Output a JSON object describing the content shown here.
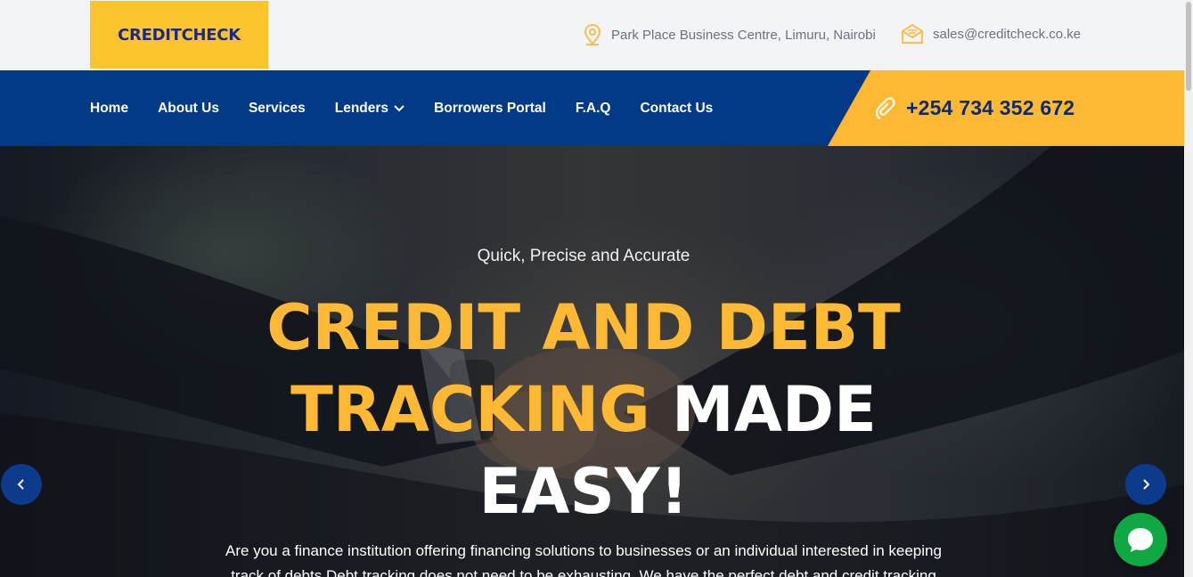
{
  "brand": {
    "logo_text": "CREDITCHECK"
  },
  "topbar": {
    "address": "Park Place Business Centre, Limuru, Nairobi",
    "email": "sales@creditcheck.co.ke",
    "address_icon": "map-pin-icon",
    "email_icon": "envelope-icon"
  },
  "nav": {
    "items": [
      {
        "label": "Home"
      },
      {
        "label": "About Us"
      },
      {
        "label": "Services"
      },
      {
        "label": "Lenders"
      },
      {
        "label": "Borrowers Portal"
      },
      {
        "label": "F.A.Q"
      },
      {
        "label": "Contact Us"
      }
    ],
    "phone": "+254 734 352 672"
  },
  "hero": {
    "subtitle": "Quick, Precise and Accurate",
    "headline_line1": "CREDIT AND DEBT",
    "headline_line2_gold": "TRACKING",
    "headline_line2_white": " MADE",
    "headline_line3": "EASY!",
    "description": "Are you a finance institution offering financing solutions to businesses or an individual interested in keeping track of debts Debt tracking does not need to be exhausting. We have the perfect debt and credit tracking"
  },
  "colors": {
    "navy": "#033a87",
    "gold": "#fdb933",
    "logo_bg": "#fdc52d",
    "chat_green": "#10a843"
  }
}
